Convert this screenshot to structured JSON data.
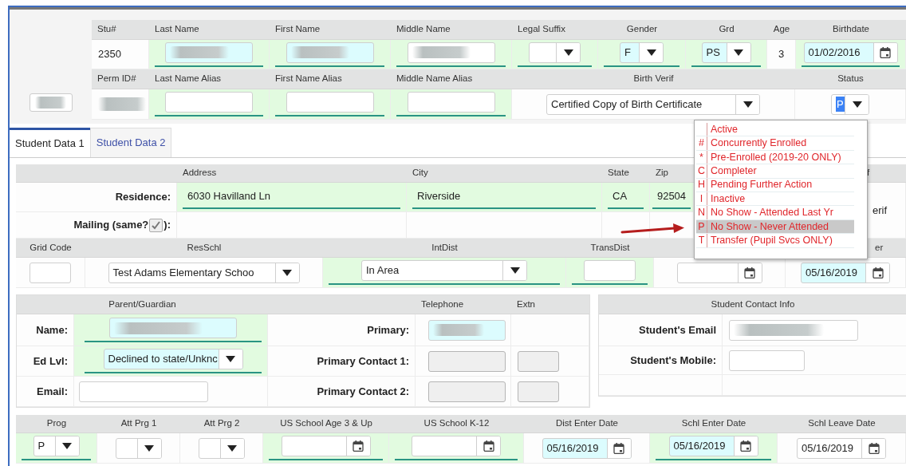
{
  "id_box": {
    "redacted": true
  },
  "student_rows": [
    {
      "cells": [
        {
          "label": "Stu#",
          "kind": "text",
          "value": "2350",
          "required": false
        },
        {
          "label": "Last Name",
          "kind": "input",
          "required": true,
          "highlighted": true,
          "redacted": true
        },
        {
          "label": "First Name",
          "kind": "input",
          "required": true,
          "highlighted": true,
          "redacted": true
        },
        {
          "label": "Middle Name",
          "kind": "input",
          "required": true,
          "highlighted": false,
          "redacted": true
        },
        {
          "label": "Legal Suffix",
          "kind": "select",
          "required": true
        },
        {
          "label": "Gender",
          "kind": "select",
          "value": "F",
          "required": true,
          "highlighted": true
        },
        {
          "label": "Grd",
          "kind": "select",
          "value": "PS",
          "required": true,
          "highlighted": true
        },
        {
          "label": "Age",
          "kind": "text",
          "value": "3",
          "required": false
        },
        {
          "label": "Birthdate",
          "kind": "date",
          "value": "01/02/2016",
          "required": true,
          "highlighted": true
        }
      ]
    },
    {
      "cells": [
        {
          "label": "Perm ID#",
          "kind": "text",
          "required": false,
          "redacted": true
        },
        {
          "label": "Last Name Alias",
          "kind": "input",
          "required": true,
          "highlighted": false
        },
        {
          "label": "First Name Alias",
          "kind": "input",
          "required": true,
          "highlighted": false
        },
        {
          "label": "Middle Name Alias",
          "kind": "input",
          "required": true,
          "highlighted": false
        },
        {
          "label": "Birth Verif",
          "kind": "select",
          "value": "Certified Copy of Birth Certificate",
          "required": false,
          "highlighted": false
        },
        {
          "label": "Status",
          "kind": "select",
          "value": "P",
          "value_selected": true,
          "open": true,
          "required": false,
          "options": [
            {
              "label": "Active",
              "selected": false
            },
            {
              "code": "#",
              "label": "Concurrently Enrolled",
              "selected": false
            },
            {
              "code": "*",
              "label": "Pre-Enrolled (2019-20 ONLY)",
              "selected": false
            },
            {
              "code": "C",
              "label": "Completer",
              "selected": false
            },
            {
              "code": "H",
              "label": "Pending Further Action",
              "selected": false
            },
            {
              "code": "I",
              "label": "Inactive",
              "selected": false
            },
            {
              "code": "N",
              "label": "No Show - Attended Last Yr",
              "selected": false
            },
            {
              "code": "P",
              "label": "No Show - Never Attended",
              "selected": true
            },
            {
              "code": "T",
              "label": "Transfer (Pupil Svcs ONLY)",
              "selected": false
            }
          ]
        }
      ]
    }
  ],
  "tabs": [
    {
      "label": "Student Data 1",
      "selected": true
    },
    {
      "label": "Student Data 2",
      "selected": false
    }
  ],
  "address": {
    "columns": [
      "Address",
      "City",
      "State",
      "Zip",
      "f"
    ],
    "residence": {
      "label": "Residence:",
      "cells": [
        {
          "kind": "text",
          "value": "6030 Havilland Ln",
          "required": true
        },
        {
          "kind": "text",
          "value": "Riverside",
          "required": true
        },
        {
          "kind": "text",
          "value": "CA",
          "required": true
        },
        {
          "kind": "text",
          "value": "92504",
          "required": true
        }
      ]
    },
    "mailing": {
      "label": "Mailing (same?",
      "label_end": "):",
      "same_as_residence": true
    },
    "side_text": "erif"
  },
  "school": {
    "cells": [
      {
        "label": "Grid Code",
        "kind": "input",
        "required": false,
        "highlighted": false
      },
      {
        "label": "ResSchl",
        "kind": "select",
        "value": "Test Adams Elementary Schoo",
        "required": false,
        "highlighted": false
      },
      {
        "label": "IntDist",
        "kind": "select",
        "value": "In Area",
        "required": true,
        "highlighted": false
      },
      {
        "label": "TransDist",
        "kind": "input",
        "required": true,
        "highlighted": false
      },
      {
        "kind": "date",
        "required": false,
        "highlighted": false
      },
      {
        "label": "er",
        "kind": "date",
        "value": "05/16/2019",
        "required": false,
        "highlighted": true
      }
    ]
  },
  "parent": {
    "title": "Parent/Guardian",
    "phone_title": "Telephone",
    "ext_title": "Extn",
    "rows": [
      {
        "label": "Name:",
        "field": {
          "kind": "input",
          "required": true,
          "highlighted": true,
          "redacted": true
        },
        "phone_label": "Primary:",
        "phone": {
          "kind": "input",
          "highlighted": true,
          "redacted": true
        }
      },
      {
        "label": "Ed Lvl:",
        "field": {
          "kind": "select",
          "value": "Declined to state/Unknc",
          "required": true,
          "highlighted": true
        },
        "phone_label": "Primary Contact 1:",
        "phone": {
          "kind": "input",
          "disabled": true
        },
        "ext": {
          "kind": "input",
          "disabled": true
        }
      },
      {
        "label": "Email:",
        "field": {
          "kind": "input",
          "required": false,
          "highlighted": false
        },
        "phone_label": "Primary Contact 2:",
        "phone": {
          "kind": "input",
          "disabled": true
        },
        "ext": {
          "kind": "input",
          "disabled": true
        }
      }
    ]
  },
  "student_contact": {
    "title": "Student Contact Info",
    "rows": [
      {
        "label": "Student's Email",
        "field": {
          "kind": "input",
          "redacted": true
        }
      },
      {
        "label": "Student's Mobile:",
        "field": {
          "kind": "input"
        }
      }
    ]
  },
  "program": {
    "cells": [
      {
        "label": "Prog",
        "kind": "select",
        "value": "P",
        "required": true
      },
      {
        "label": "Att Prg 1",
        "kind": "select"
      },
      {
        "label": "Att Prg 2",
        "kind": "select"
      },
      {
        "label": "US School Age 3 & Up",
        "kind": "date",
        "required": true
      },
      {
        "label": "US School K-12",
        "kind": "date",
        "required": true
      },
      {
        "label": "Dist Enter Date",
        "kind": "date",
        "value": "05/16/2019",
        "required": false,
        "highlighted": true
      },
      {
        "label": "Schl Enter Date",
        "kind": "date",
        "value": "05/16/2019",
        "required": true,
        "highlighted": true
      },
      {
        "label": "Schl Leave Date",
        "kind": "date",
        "value": "05/16/2019",
        "required": false,
        "highlighted": false
      }
    ]
  }
}
